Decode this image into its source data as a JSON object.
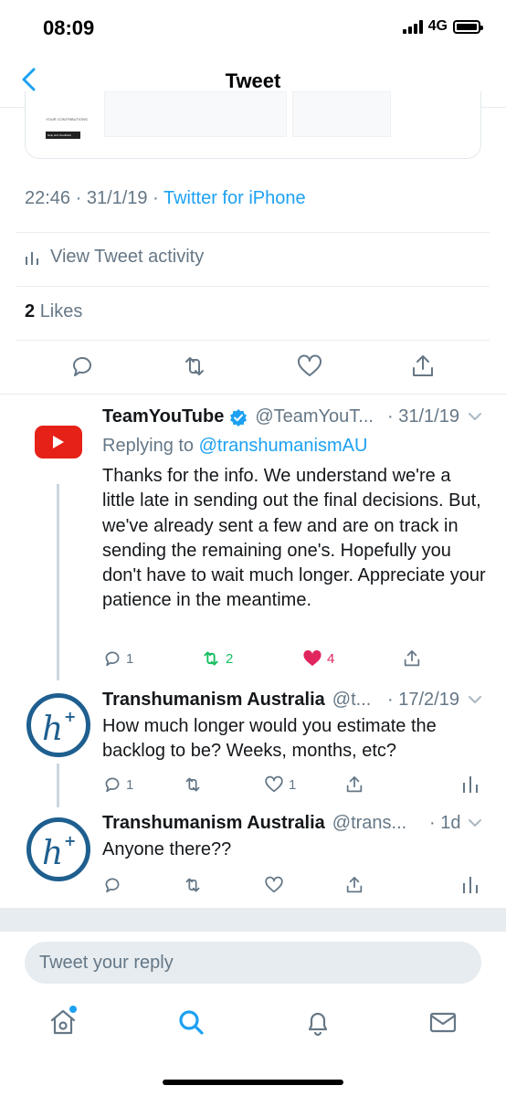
{
  "status_bar": {
    "time": "08:09",
    "network": "4G"
  },
  "nav": {
    "title": "Tweet"
  },
  "embed_card": {
    "line": "YOUR CONTRIBUTIONS",
    "button": "Help and Feedback"
  },
  "meta": {
    "timestamp": "22:46 · 31/1/19 · ",
    "source": "Twitter for iPhone"
  },
  "activity_label": "View Tweet activity",
  "likes": {
    "count": "2",
    "label": "Likes"
  },
  "tweets": [
    {
      "name": "TeamYouTube",
      "handle": "@TeamYouT...",
      "date": "· 31/1/19",
      "replying_label": "Replying to ",
      "replying_to": "@transhumanismAU",
      "body": "Thanks for the info. We understand we're a little late in sending out the final decisions. But, we've already sent a few and are on track in sending the remaining one's. Hopefully you don't have to wait much longer. Appreciate your patience in the meantime.",
      "replies": "1",
      "retweets": "2",
      "likes": "4"
    },
    {
      "name": "Transhumanism Australia",
      "handle": "@t...",
      "date": "· 17/2/19",
      "body": "How much longer would you estimate the backlog to be? Weeks, months, etc?",
      "replies": "1",
      "likes": "1"
    },
    {
      "name": "Transhumanism Australia",
      "handle": "@trans...",
      "date": "· 1d",
      "body": "Anyone there??"
    }
  ],
  "reply_bar": {
    "placeholder": "Tweet your reply"
  },
  "icons": {
    "accent": "#1da1f2",
    "grey": "#657786",
    "retweet_active": "#17bf63",
    "like_active": "#e0245e",
    "youtube_red": "#e62117",
    "transhumanism_blue": "#1e5f8f"
  }
}
